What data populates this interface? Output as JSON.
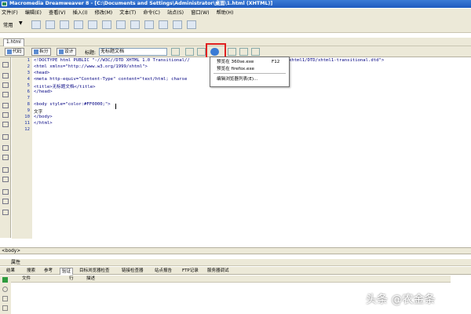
{
  "window": {
    "title": "Macromedia Dreamweaver 8 - [C:\\Documents and Settings\\Administrator\\桌面\\1.html (XHTML)]"
  },
  "menubar": {
    "items": [
      "文件(F)",
      "编辑(E)",
      "查看(V)",
      "插入(I)",
      "修改(M)",
      "文本(T)",
      "命令(C)",
      "站点(S)",
      "窗口(W)",
      "帮助(H)"
    ]
  },
  "insertbar": {
    "category": "常用"
  },
  "doctab": {
    "label": "1.html"
  },
  "doctoolbar": {
    "code_label": "代码",
    "split_label": "拆分",
    "design_label": "设计",
    "title_label": "标题:",
    "title_value": "无标题文档"
  },
  "preview_menu": {
    "items": [
      {
        "label": "预览在 360se.exe",
        "shortcut": "F12"
      },
      {
        "label": "预览在 firefox.exe",
        "shortcut": ""
      },
      {
        "label": "编辑浏览器列表(E)...",
        "shortcut": ""
      }
    ]
  },
  "code": {
    "line_numbers": [
      "1",
      "2",
      "3",
      "4",
      "5",
      "6",
      "7",
      "8",
      "9",
      "10",
      "11",
      "12"
    ],
    "lines": [
      "<!DOCTYPE html PUBLIC \"-//W3C//DTD XHTML 1.0 Transitional//",
      "<html xmlns=\"http://www.w3.org/1999/xhtml\">",
      "<head>",
      "<meta http-equiv=\"Content-Type\" content=\"text/html; charse",
      "<title>无标题文档</title>",
      "</head>",
      "",
      "<body style=\"color:#FF0000;\">",
      "文字",
      "</body>",
      "</html>",
      ""
    ],
    "line1_tail": "xhtml1/DTD/xhtml1-transitional.dtd\">"
  },
  "tagselector": {
    "text": "<body>"
  },
  "properties_panel": {
    "title": "属性"
  },
  "results_panel": {
    "tabs": [
      "结果",
      "搜索",
      "参考",
      "验证",
      "目标浏览器检查",
      "链接检查器",
      "站点报告",
      "FTP记录",
      "服务器调试"
    ],
    "active_tab": "验证",
    "columns": [
      "文件",
      "行",
      "描述"
    ]
  },
  "watermark": {
    "text": "头条 @农金条"
  },
  "colors": {
    "title_bar": "#1f5bbf",
    "chrome": "#ece9d8",
    "code_tag": "#000080",
    "line_number": "#1c33a8",
    "highlight_box": "#e02020"
  }
}
